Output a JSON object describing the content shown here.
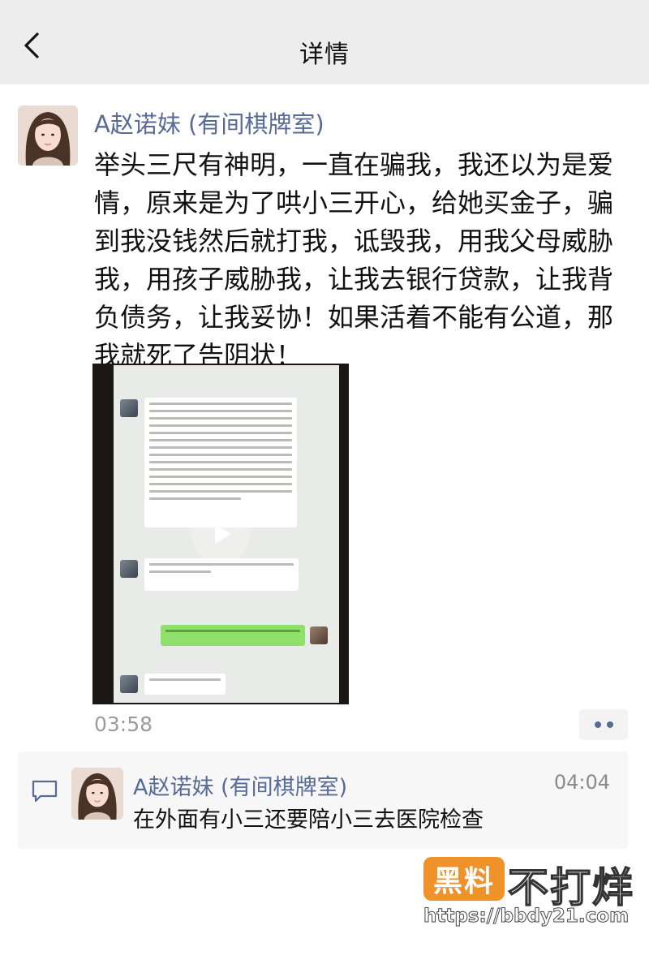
{
  "header": {
    "title": "详情",
    "back_icon": "chevron-left-icon"
  },
  "post": {
    "author": "A赵诺妹 (有间棋牌室)",
    "text": "举头三尺有神明，一直在骗我，我还以为是爱情，原来是为了哄小三开心，给她买金子，骗到我没钱然后就打我，诋毁我，用我父母威胁我，用孩子威胁我，让我去银行贷款，让我背负债务，让我妥协！如果活着不能有公道，那我就死了告阴状！",
    "time": "03:58",
    "video": {
      "play_icon": "play-icon"
    },
    "more_icon": "more-dots-icon"
  },
  "comments": [
    {
      "author": "A赵诺妹 (有间棋牌室)",
      "time": "04:04",
      "text": "在外面有小三还要陪小三去医院检查"
    }
  ],
  "comment_icon": "comment-bubble-icon",
  "watermark": {
    "logo": "黑料",
    "text": "不打烊",
    "url": "https://bbdy21.com"
  },
  "colors": {
    "link": "#576b95",
    "topbar": "#ededed",
    "accent": "#f0922a"
  }
}
